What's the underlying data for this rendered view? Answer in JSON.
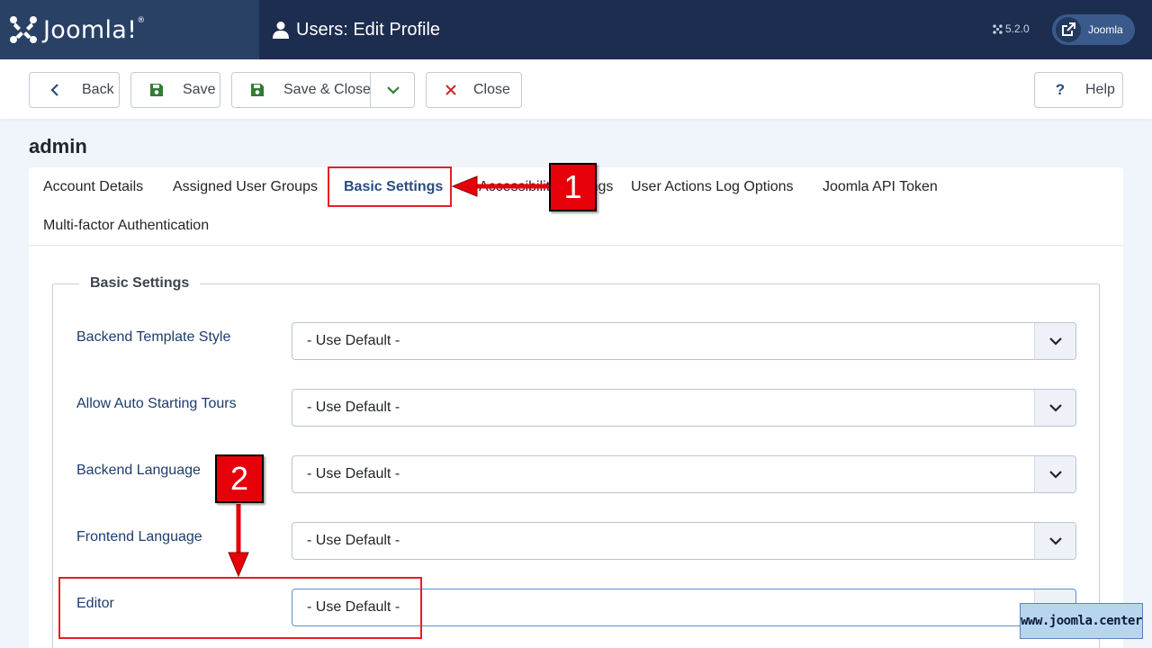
{
  "header": {
    "brand": "Joomla!",
    "brand_reg": "®",
    "title": "Users: Edit Profile",
    "version": "5.2.0",
    "user_label": "Joomla"
  },
  "toolbar": {
    "back_label": "Back",
    "save_label": "Save",
    "save_close_label": "Save & Close",
    "close_label": "Close",
    "help_label": "Help"
  },
  "record": {
    "title": "admin"
  },
  "tabs": [
    {
      "label": "Account Details"
    },
    {
      "label": "Assigned User Groups"
    },
    {
      "label": "Basic Settings",
      "active": true
    },
    {
      "label": "Accessibility Settings"
    },
    {
      "label": "User Actions Log Options"
    },
    {
      "label": "Joomla API Token"
    },
    {
      "label": "Multi-factor Authentication"
    }
  ],
  "basic_settings": {
    "legend": "Basic Settings",
    "fields": [
      {
        "label": "Backend Template Style",
        "value": "- Use Default -"
      },
      {
        "label": "Allow Auto Starting Tours",
        "value": "- Use Default -"
      },
      {
        "label": "Backend Language",
        "value": "- Use Default -"
      },
      {
        "label": "Frontend Language",
        "value": "- Use Default -"
      },
      {
        "label": "Editor",
        "value": "- Use Default -"
      }
    ]
  },
  "annotations": {
    "step1": "1",
    "step2": "2",
    "color": "#e41f26"
  },
  "watermark": "www.joomla.center",
  "colors": {
    "header_bg": "#1c2d4f",
    "logo_bg": "#2a4166",
    "active_tab": "#2a4d7f",
    "label_blue": "#1c3d6e"
  }
}
